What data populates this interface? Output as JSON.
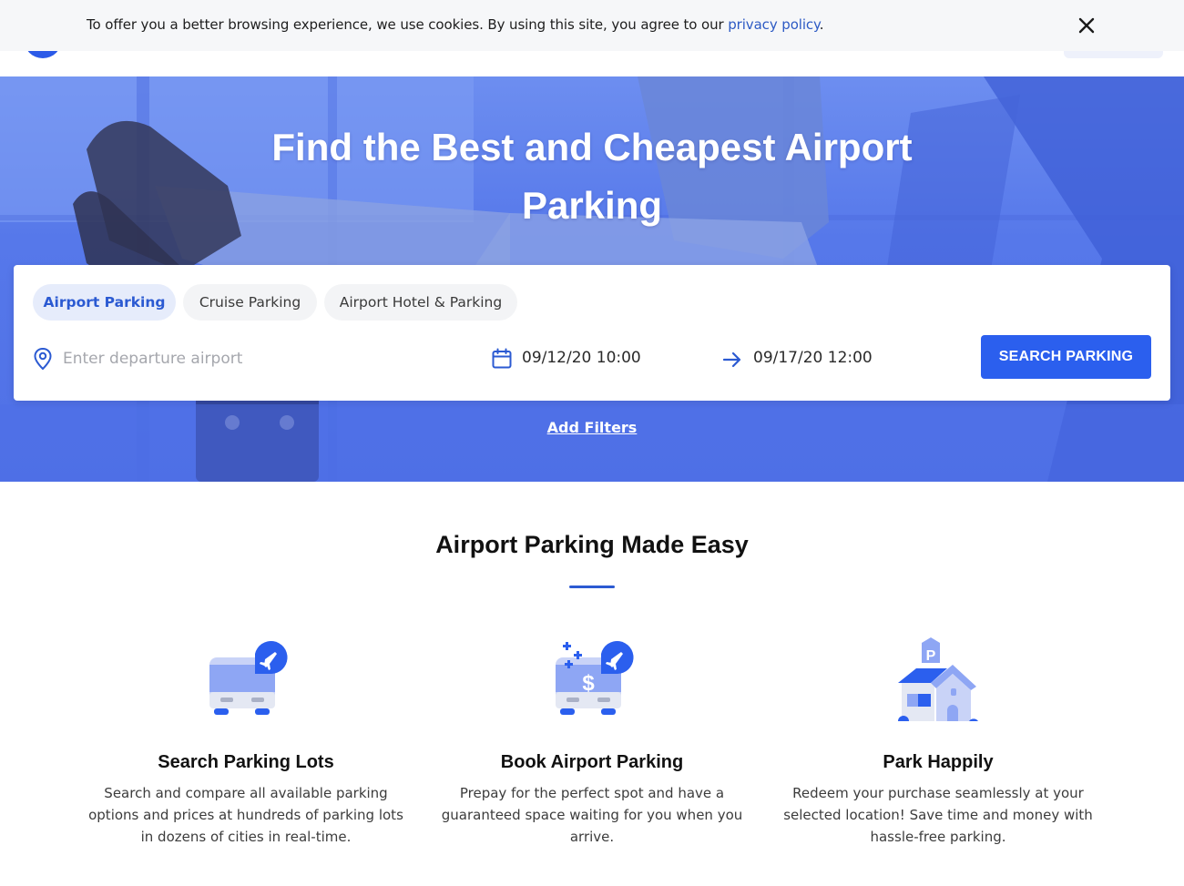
{
  "cookie": {
    "text": "To offer you a better browsing experience, we use cookies. By using this site, you agree to our ",
    "link": "privacy policy",
    "suffix": "."
  },
  "hero": {
    "title": "Find the Best and Cheapest Airport Parking"
  },
  "search": {
    "tabs": [
      {
        "label": "Airport Parking",
        "active": true
      },
      {
        "label": "Cruise Parking",
        "active": false
      },
      {
        "label": "Airport Hotel & Parking",
        "active": false
      }
    ],
    "airport_placeholder": "Enter departure airport",
    "start_date": "09/12/20 10:00",
    "end_date": "09/17/20 12:00",
    "button_label": "SEARCH PARKING",
    "add_filters": "Add Filters"
  },
  "section": {
    "title": "Airport Parking Made Easy",
    "features": [
      {
        "icon": "bus-plane-icon",
        "title": "Search Parking Lots",
        "description": "Search and compare all available parking options and prices at hundreds of parking lots in dozens of cities in real-time."
      },
      {
        "icon": "bus-dollar-plane-icon",
        "title": "Book Airport Parking",
        "description": "Prepay for the perfect spot and have a guaranteed space waiting for you when you arrive."
      },
      {
        "icon": "parking-house-icon",
        "title": "Park Happily",
        "description": "Redeem your purchase seamlessly at your selected location! Save time and money with hassle-free parking."
      }
    ]
  },
  "colors": {
    "brand": "#2b5fee",
    "hero_tint": "#5678ea",
    "accent_text": "#2b5ad2"
  }
}
